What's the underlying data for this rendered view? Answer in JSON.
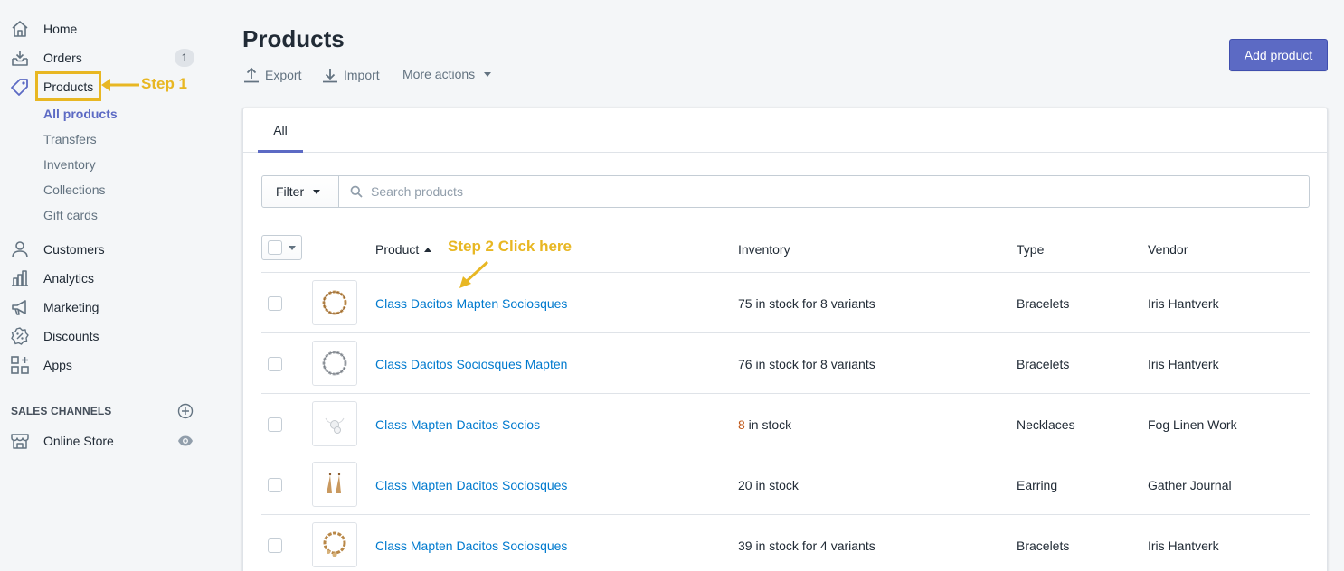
{
  "sidebar": {
    "items": [
      {
        "label": "Home",
        "icon": "home-icon"
      },
      {
        "label": "Orders",
        "icon": "orders-icon",
        "badge": "1"
      },
      {
        "label": "Products",
        "icon": "tag-icon"
      },
      {
        "label": "Customers",
        "icon": "customers-icon"
      },
      {
        "label": "Analytics",
        "icon": "analytics-icon"
      },
      {
        "label": "Marketing",
        "icon": "marketing-icon"
      },
      {
        "label": "Discounts",
        "icon": "discounts-icon"
      },
      {
        "label": "Apps",
        "icon": "apps-icon"
      }
    ],
    "sub_items": [
      {
        "label": "All products",
        "active": true
      },
      {
        "label": "Transfers"
      },
      {
        "label": "Inventory"
      },
      {
        "label": "Collections"
      },
      {
        "label": "Gift cards"
      }
    ],
    "channels_title": "SALES CHANNELS",
    "channels": [
      {
        "label": "Online Store",
        "icon": "store-icon"
      }
    ]
  },
  "annotations": {
    "step1": "Step 1",
    "step2": "Step 2 Click here",
    "color": "#e8b723"
  },
  "header": {
    "title": "Products",
    "export_label": "Export",
    "import_label": "Import",
    "more_actions_label": "More actions",
    "add_button_label": "Add product"
  },
  "tabs": [
    {
      "label": "All",
      "active": true
    }
  ],
  "filter": {
    "filter_label": "Filter",
    "search_placeholder": "Search products"
  },
  "table": {
    "columns": [
      "Product",
      "Inventory",
      "Type",
      "Vendor"
    ],
    "rows": [
      {
        "name": "Class Dacitos Mapten Sociosques",
        "inventory": "75 in stock for 8 variants",
        "type": "Bracelets",
        "vendor": "Iris Hantverk",
        "thumb": "gold-bracelet"
      },
      {
        "name": "Class Dacitos Sociosques Mapten",
        "inventory": "76 in stock for 8 variants",
        "type": "Bracelets",
        "vendor": "Iris Hantverk",
        "thumb": "silver-bracelet"
      },
      {
        "name": "Class Mapten Dacitos Socios",
        "inventory_count": "8",
        "inventory_suffix": " in stock",
        "type": "Necklaces",
        "vendor": "Fog Linen Work",
        "thumb": "necklace"
      },
      {
        "name": "Class Mapten Dacitos Sociosques",
        "inventory": "20 in stock",
        "type": "Earring",
        "vendor": "Gather Journal",
        "thumb": "earrings"
      },
      {
        "name": "Class Mapten Dacitos Sociosques",
        "inventory": "39 in stock for 4 variants",
        "type": "Bracelets",
        "vendor": "Iris Hantverk",
        "thumb": "charm-bracelet"
      }
    ]
  },
  "colors": {
    "accent": "#5c6ac4",
    "link": "#007ace",
    "low_stock": "#c05717"
  }
}
